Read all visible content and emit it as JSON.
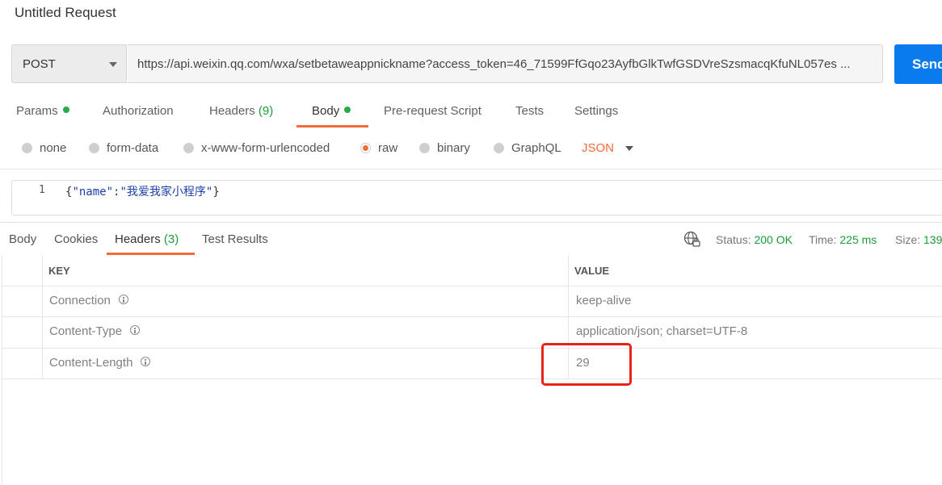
{
  "request": {
    "title": "Untitled Request",
    "method": "POST",
    "url": "https://api.weixin.qq.com/wxa/setbetaweappnickname?access_token=46_71599FfGqo23AyfbGlkTwfGSDVreSzsmacqKfuNL057es ...",
    "send_label": "Send"
  },
  "request_tabs": {
    "params": "Params",
    "authorization": "Authorization",
    "headers": "Headers",
    "headers_count": "(9)",
    "body": "Body",
    "prerequest": "Pre-request Script",
    "tests": "Tests",
    "settings": "Settings",
    "active": "Body"
  },
  "body_types": {
    "none": "none",
    "form_data": "form-data",
    "urlencoded": "x-www-form-urlencoded",
    "raw": "raw",
    "binary": "binary",
    "graphql": "GraphQL",
    "selected": "raw",
    "format": "JSON"
  },
  "editor": {
    "line_number": "1",
    "open": "{",
    "key": "\"name\"",
    "colon": ":",
    "value": "\"我爱我家小程序\"",
    "close": "}"
  },
  "response_tabs": {
    "body": "Body",
    "cookies": "Cookies",
    "headers": "Headers",
    "headers_count": "(3)",
    "test_results": "Test Results",
    "active": "Headers"
  },
  "response_status": {
    "status_label": "Status:",
    "status_value": "200 OK",
    "time_label": "Time:",
    "time_value": "225 ms",
    "size_label": "Size:",
    "size_value": "139"
  },
  "response_headers": {
    "columns": {
      "key": "KEY",
      "value": "VALUE"
    },
    "rows": [
      {
        "key": "Connection",
        "value": "keep-alive"
      },
      {
        "key": "Content-Type",
        "value": "application/json; charset=UTF-8"
      },
      {
        "key": "Content-Length",
        "value": "29"
      }
    ]
  },
  "colors": {
    "accent": "#f26b3a",
    "send_button": "#097bed",
    "status_green": "#1a9c3a",
    "highlight_box": "#e8231a"
  }
}
